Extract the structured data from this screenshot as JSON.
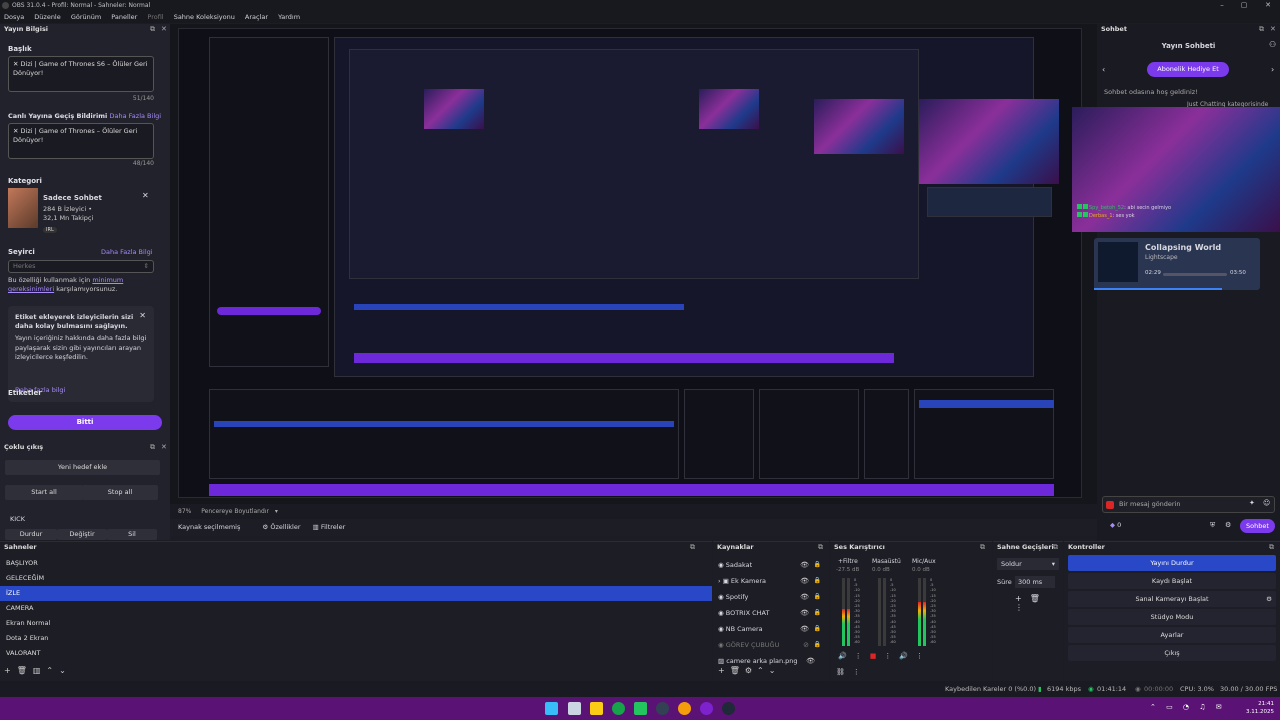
{
  "window": {
    "title": "OBS 31.0.4 - Profil: Normal - Sahneler: Normal",
    "min": "–",
    "max": "▢",
    "close": "✕"
  },
  "menu": {
    "items": [
      "Dosya",
      "Düzenle",
      "Görünüm",
      "Paneller",
      "Profil",
      "Sahne Koleksiyonu",
      "Araçlar",
      "Yardım"
    ]
  },
  "stream_info": {
    "dock_title": "Yayın Bilgisi",
    "title_label": "Başlık",
    "title_value": "✕ Dizi | Game of Thrones S6 – Ölüler Geri Dönüyor!",
    "title_counter": "51/140",
    "live_notice_label": "Canlı Yayına Geçiş Bildirimi",
    "more_info": "Daha Fazla Bilgi",
    "live_notice_value": "✕ Dizi | Game of Thrones – Ölüler Geri Dönüyor!",
    "live_notice_counter": "48/140",
    "category_label": "Kategori",
    "category_name": "Sadece Sohbet",
    "category_viewers": "284 B İzleyici •",
    "category_followers": "32,1 Mn Takipçi",
    "category_tag": "IRL",
    "audience_label": "Seyirci",
    "audience_more": "Daha Fazla Bilgi",
    "audience_value": "Herkes",
    "audience_note_1": "Bu özelliği kullanmak için",
    "audience_note_link": "minimum gereksinimleri",
    "audience_note_2": "karşılamıyorsunuz.",
    "tip_bold": "Etiket ekleyerek izleyicilerin sizi daha kolay bulmasını sağlayın.",
    "tip_text": "Yayın içeriğiniz hakkında daha fazla bilgi paylaşarak sizin gibi yayıncıları arayan izleyicilerce keşfedilin.",
    "tip_link": "Daha fazla bilgi",
    "tags_label": "Etiketler",
    "done_button": "Bitti"
  },
  "multistream": {
    "dock_title": "Çoklu çıkış",
    "add_target": "Yeni hedef ekle",
    "start_all": "Start all",
    "stop_all": "Stop all",
    "kick_label": "KICK",
    "stop": "Durdur",
    "edit": "Değiştir",
    "delete": "Sil"
  },
  "preview": {
    "zoom": "87%",
    "fit_mode": "Pencereye Boyutlandır",
    "no_source": "Kaynak seçilmemiş",
    "properties": "Özellikler",
    "filters": "Filtreler"
  },
  "chat": {
    "dock_title": "Sohbet",
    "header": "Yayın Sohbeti",
    "gift_button": "Abonelik Hediye Et",
    "welcome": "Sohbet odasına hoş geldiniz!",
    "msg_fragment": "Just Chatting kategorisinde",
    "msg1_user": "Spy_betoh_52",
    "msg1_text": ": abi secin gelmiyo",
    "msg2_user": "Derbas_1",
    "msg2_text": ": ses yok",
    "np_title": "Collapsing World",
    "np_artist": "Lightscape",
    "np_time_elapsed": "02:29",
    "np_time_total": "03:50",
    "input_placeholder": "Bir mesaj gönderin",
    "points": "0",
    "send_button": "Sohbet"
  },
  "scenes": {
    "dock_title": "Sahneler",
    "items": [
      "BAŞLIYOR",
      "GELECEĞİM",
      "İZLE",
      "CAMERA",
      "Ekran Normal",
      "Dota 2 Ekran",
      "VALORANT"
    ],
    "active_index": 2
  },
  "sources": {
    "dock_title": "Kaynaklar",
    "items": [
      "Sadakat",
      "Ek Kamera",
      "Spotify",
      "BOTRIX CHAT",
      "NB Camera",
      "GÖREV ÇUBUĞU",
      "camere arka plan.png"
    ]
  },
  "mixer": {
    "dock_title": "Ses Karıştırıcı",
    "channels": [
      {
        "name": "+Filtre",
        "db": "-27.5 dB",
        "level": 0.55
      },
      {
        "name": "Masaüstü",
        "db": "0.0 dB",
        "level": 0.0
      },
      {
        "name": "Mic/Aux",
        "db": "0.0 dB",
        "level": 0.65
      }
    ],
    "scale": [
      "0",
      "-5",
      "-10",
      "-15",
      "-20",
      "-25",
      "-30",
      "-35",
      "-40",
      "-45",
      "-50",
      "-55",
      "-60"
    ]
  },
  "transitions": {
    "dock_title": "Sahne Geçişleri",
    "selected": "Soldur",
    "duration_label": "Süre",
    "duration_value": "300 ms"
  },
  "controls": {
    "dock_title": "Kontroller",
    "buttons": [
      "Yayını Durdur",
      "Kaydı Başlat",
      "Sanal Kamerayı Başlat",
      "Stüdyo Modu",
      "Ayarlar",
      "Çıkış"
    ]
  },
  "status": {
    "dropped": "Kaybedilen Kareler 0 (%0.0)",
    "bitrate": "6194 kbps",
    "stream_time": "01:41:14",
    "rec_time": "00:00:00",
    "cpu": "CPU: 3.0%",
    "fps": "30.00 / 30.00 FPS"
  },
  "taskbar": {
    "time": "21:41",
    "date": "3.11.2025"
  },
  "colors": {
    "accent": "#7c3aed",
    "selection": "#2848c8",
    "taskbar": "#5a1275"
  }
}
